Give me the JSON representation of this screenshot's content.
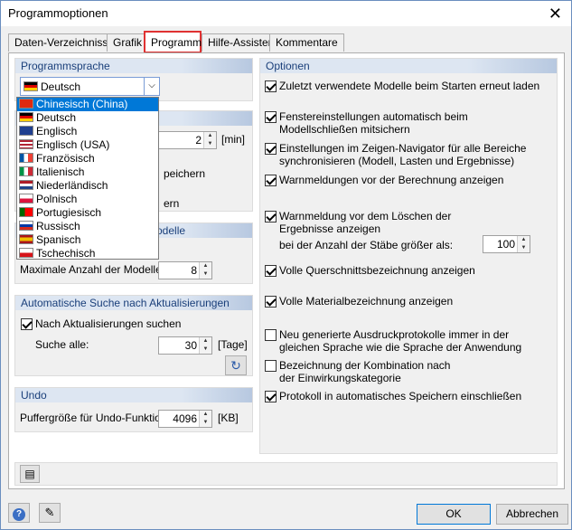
{
  "window": {
    "title": "Programmoptionen",
    "close_glyph": "✕"
  },
  "tabs": [
    "Daten-Verzeichnisse",
    "Grafik",
    "Programm",
    "Hilfe-Assistent",
    "Kommentare"
  ],
  "left": {
    "language": {
      "header": "Programmsprache",
      "selected": "Deutsch",
      "options": [
        "Chinesisch  (China)",
        "Deutsch",
        "Englisch",
        "Englisch (USA)",
        "Französisch",
        "Italienisch",
        "Niederländisch",
        "Polnisch",
        "Portugiesisch",
        "Russisch",
        "Spanisch",
        "Tschechisch"
      ]
    },
    "autosave": {
      "value": "2",
      "unit": "[min]",
      "partial_1": "peichern",
      "partial_2": "ern"
    },
    "models": {
      "header_partial": "odelle",
      "label": "Maximale Anzahl der Modelle:",
      "value": "8"
    },
    "updates": {
      "header": "Automatische Suche nach Aktualisierungen",
      "check_label": "Nach Aktualisierungen suchen",
      "search_label": "Suche alle:",
      "value": "30",
      "unit": "[Tage]"
    },
    "undo": {
      "header": "Undo",
      "label": "Puffergröße für Undo-Funktion:",
      "value": "4096",
      "unit": "[KB]"
    }
  },
  "options": {
    "header": "Optionen",
    "items": [
      "Zuletzt verwendete Modelle beim Starten erneut laden",
      "Fenstereinstellungen automatisch beim Modellschließen mitsichern",
      "Einstellungen im Zeigen-Navigator für alle Bereiche synchronisieren (Modell, Lasten und Ergebnisse)",
      "Warnmeldungen vor der Berechnung anzeigen",
      "Warnmeldung vor dem Löschen der Ergebnisse anzeigen",
      "Volle Querschnittsbezeichnung anzeigen",
      "Volle Materialbezeichnung anzeigen",
      "Neu generierte Ausdruckprotokolle immer in der gleichen Sprache wie die Sprache der Anwendung",
      "Bezeichnung der Kombination nach der Einwirkungskategorie",
      "Protokoll in automatisches Speichern einschließen"
    ],
    "bars_label": "bei der Anzahl der Stäbe größer als:",
    "bars_value": "100"
  },
  "footer": {
    "ok": "OK",
    "cancel": "Abbrechen"
  }
}
